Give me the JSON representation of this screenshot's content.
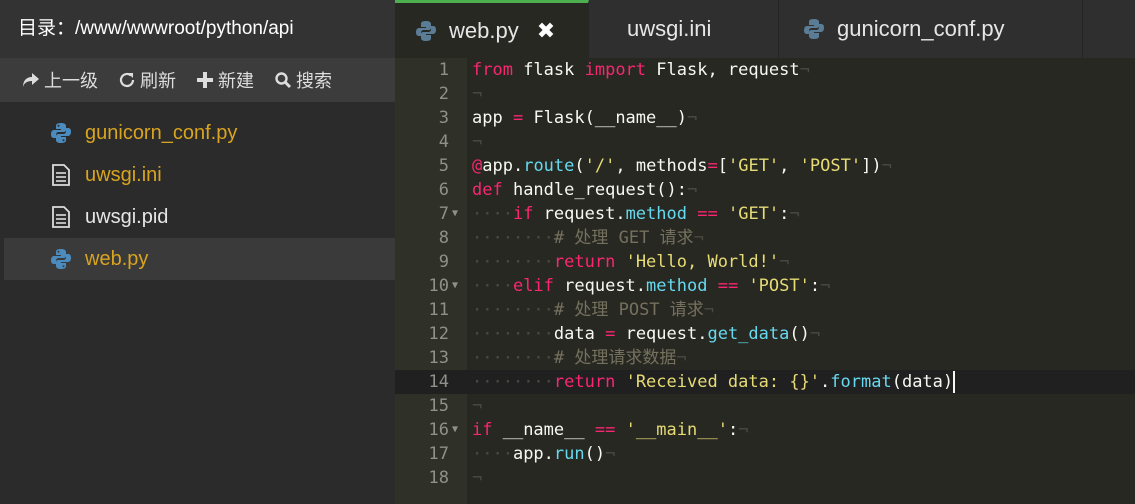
{
  "sidebar": {
    "path_label": "目录：/www/wwwroot/python/api",
    "toolbar": {
      "up_label": "上一级",
      "refresh_label": "刷新",
      "new_label": "新建",
      "search_label": "搜索"
    },
    "files": [
      {
        "name": "gunicorn_conf.py",
        "icon": "python-icon"
      },
      {
        "name": "uwsgi.ini",
        "icon": "document-icon"
      },
      {
        "name": "uwsgi.pid",
        "icon": "document-icon"
      },
      {
        "name": "web.py",
        "icon": "python-icon"
      }
    ]
  },
  "editor": {
    "tabs": [
      {
        "label": "web.py",
        "icon": "python-icon",
        "active": true,
        "close_label": "✖"
      },
      {
        "label": "uwsgi.ini",
        "icon": "none",
        "active": false
      },
      {
        "label": "gunicorn_conf.py",
        "icon": "python-icon",
        "active": false
      }
    ],
    "line_numbers": [
      "1",
      "2",
      "3",
      "4",
      "5",
      "6",
      "7",
      "8",
      "9",
      "10",
      "11",
      "12",
      "13",
      "14",
      "15",
      "16",
      "17",
      "18"
    ],
    "current_line": "14",
    "colors": {
      "keyword": "#f92672",
      "string": "#e6db74",
      "function": "#66d9ef",
      "comment": "#75715e",
      "active_tab_accent": "#4caf50",
      "filename_accent": "#d9a41f"
    }
  }
}
